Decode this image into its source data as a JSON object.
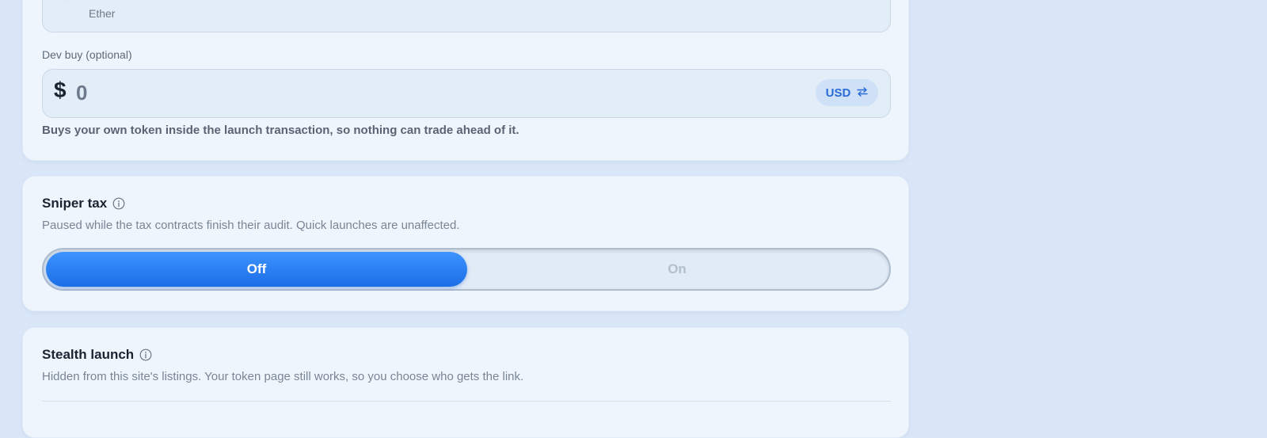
{
  "launch_card": {
    "currency_select": {
      "subtitle": "Ether",
      "icon": "ethereum-icon"
    },
    "dev_buy": {
      "label": "Dev buy (optional)",
      "currency_symbol": "$",
      "value": "",
      "placeholder": "0",
      "unit_toggle_label": "USD",
      "unit_toggle_icon": "swap-arrows-icon",
      "helper": "Buys your own token inside the launch transaction, so nothing can trade ahead of it."
    }
  },
  "sniper_tax": {
    "title": "Sniper tax",
    "description": "Paused while the tax contracts finish their audit. Quick launches are unaffected.",
    "options": [
      "Off",
      "On"
    ],
    "selected": "Off"
  },
  "stealth_launch": {
    "title": "Stealth launch",
    "description": "Hidden from this site's listings. Your token page still works, so you choose who gets the link."
  },
  "colors": {
    "accent": "#1f74f0",
    "background": "#d9e7f8",
    "card": "#eef5fd"
  }
}
